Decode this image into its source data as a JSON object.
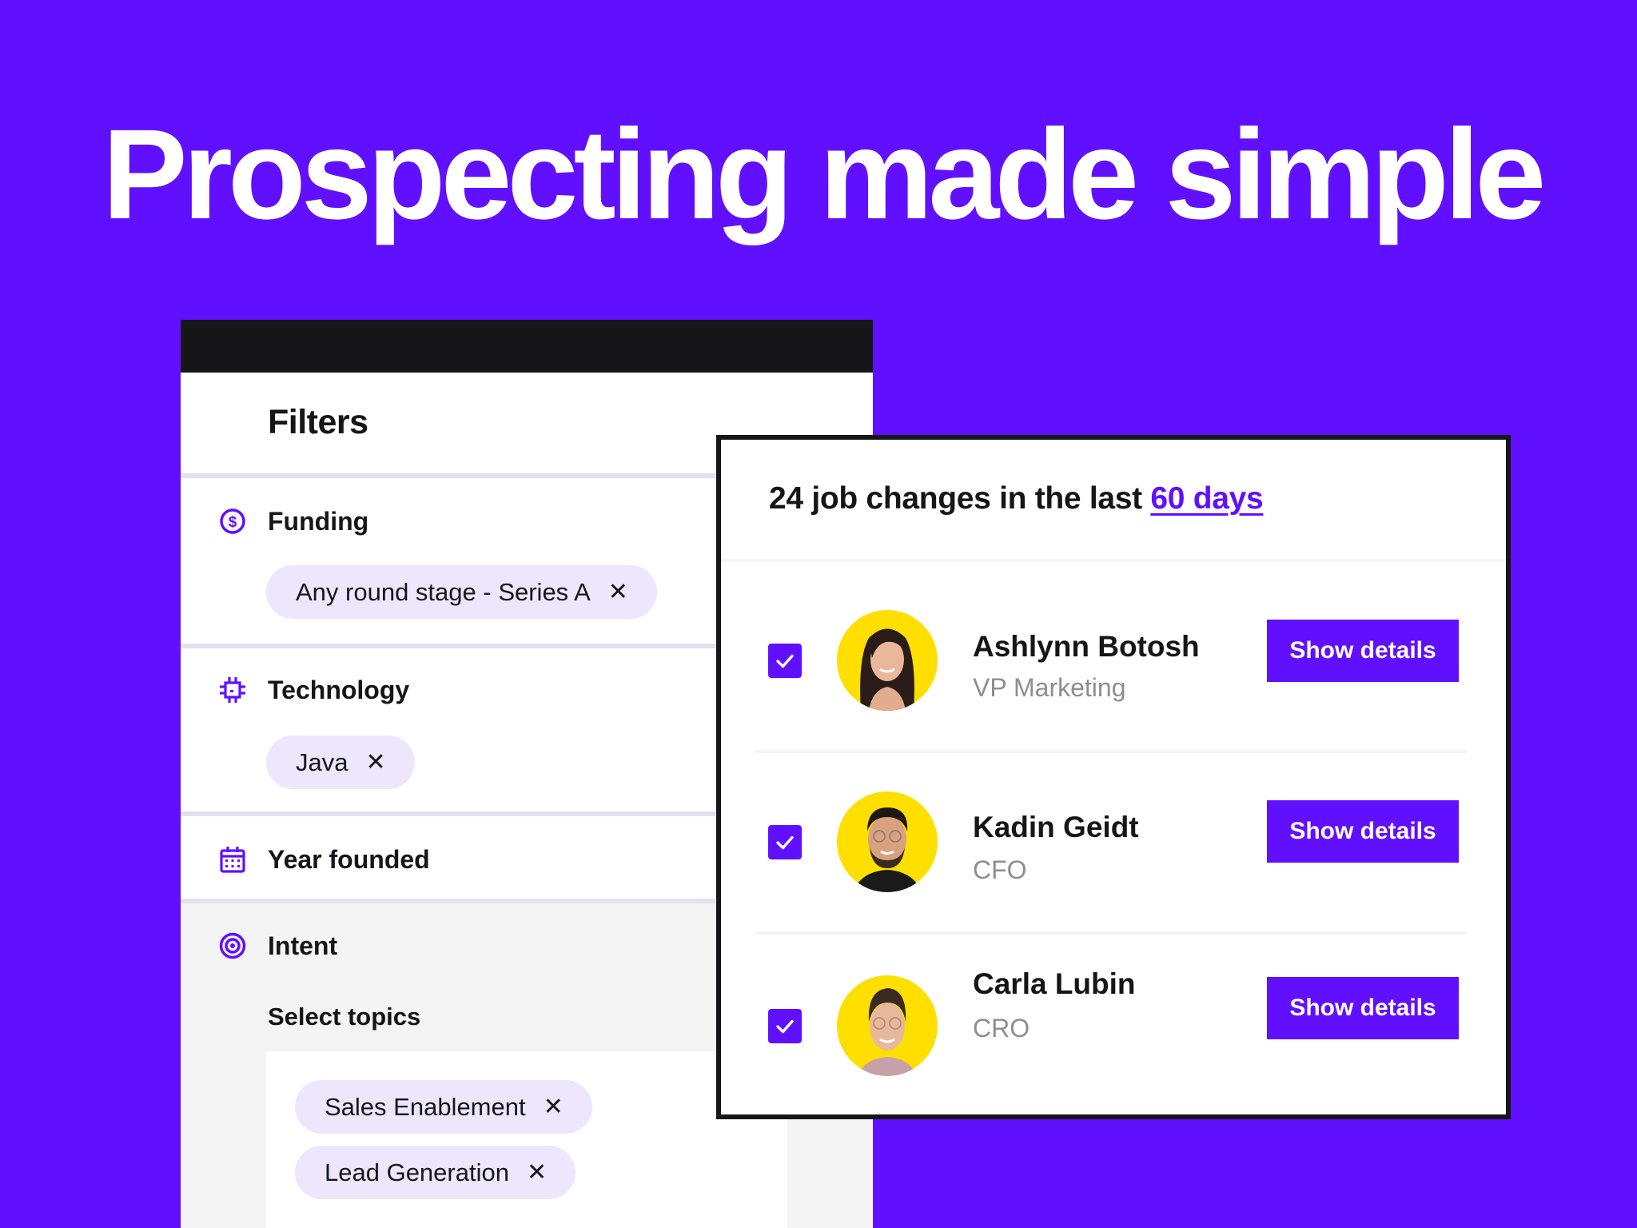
{
  "headline": "Prospecting made simple",
  "colors": {
    "brand": "#6010FF",
    "dark": "#161618",
    "chip_bg": "#EDE6FD",
    "separator": "#E4E0F0",
    "avatar_bg": "#FFDF00",
    "muted_text": "#8E8E8E"
  },
  "filters": {
    "title": "Filters",
    "sections": [
      {
        "label": "Funding",
        "icon": "dollar-circle-icon",
        "chips": [
          "Any round stage - Series A"
        ]
      },
      {
        "label": "Technology",
        "icon": "chip-icon",
        "chips": [
          "Java"
        ]
      },
      {
        "label": "Year founded",
        "icon": "calendar-icon",
        "chips": []
      },
      {
        "label": "Intent",
        "icon": "target-icon",
        "sublabel": "Select topics",
        "chips": [
          "Sales Enablement",
          "Lead Generation"
        ]
      }
    ],
    "remove_glyph": "✕"
  },
  "job_changes": {
    "heading_prefix": "24 job changes in the last ",
    "heading_link": "60 days",
    "people": [
      {
        "name": "Ashlynn Botosh",
        "title": "VP Marketing",
        "checked": true,
        "button": "Show details"
      },
      {
        "name": "Kadin Geidt",
        "title": "CFO",
        "checked": true,
        "button": "Show details"
      },
      {
        "name": "Carla Lubin",
        "title": "CRO",
        "checked": true,
        "button": "Show details"
      }
    ]
  }
}
